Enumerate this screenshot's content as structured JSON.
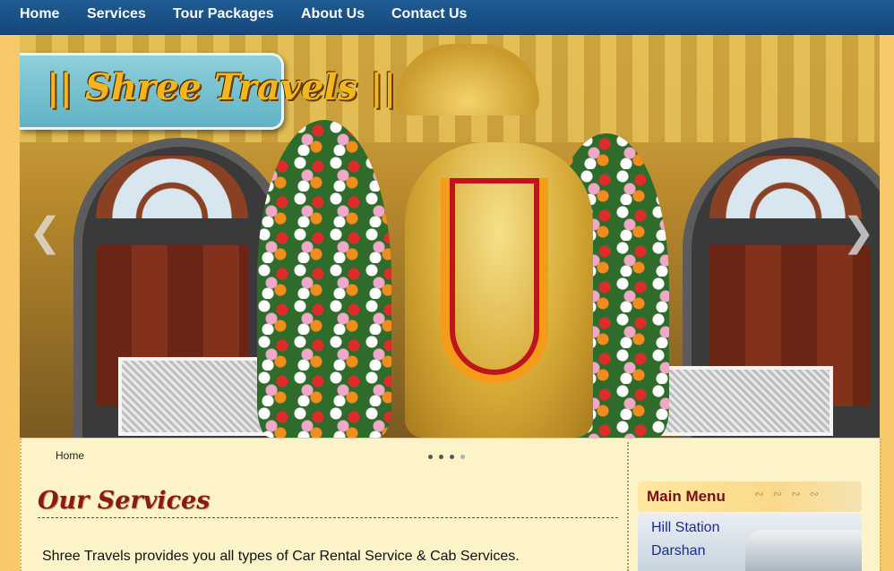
{
  "nav": {
    "items": [
      {
        "label": "Home"
      },
      {
        "label": "Services"
      },
      {
        "label": "Tour Packages"
      },
      {
        "label": "About Us"
      },
      {
        "label": "Contact Us"
      }
    ]
  },
  "hero": {
    "logo_text": "|| Shree Travels ||",
    "prev_icon": "chevron-left-icon",
    "next_icon": "chevron-right-icon",
    "slide_count": 4,
    "active_slide": 4
  },
  "breadcrumb": {
    "home": "Home"
  },
  "main": {
    "title": "Our Services",
    "intro": "Shree Travels provides you all types of Car Rental Service & Cab Services."
  },
  "sidebar": {
    "heading": "Main Menu",
    "items": [
      {
        "label": "Hill Station"
      },
      {
        "label": "Darshan"
      }
    ]
  },
  "colors": {
    "nav_bg": "#1a5288",
    "content_bg": "#fdf3c9",
    "title": "#8b1a10",
    "menu_link": "#1a2c8c"
  }
}
